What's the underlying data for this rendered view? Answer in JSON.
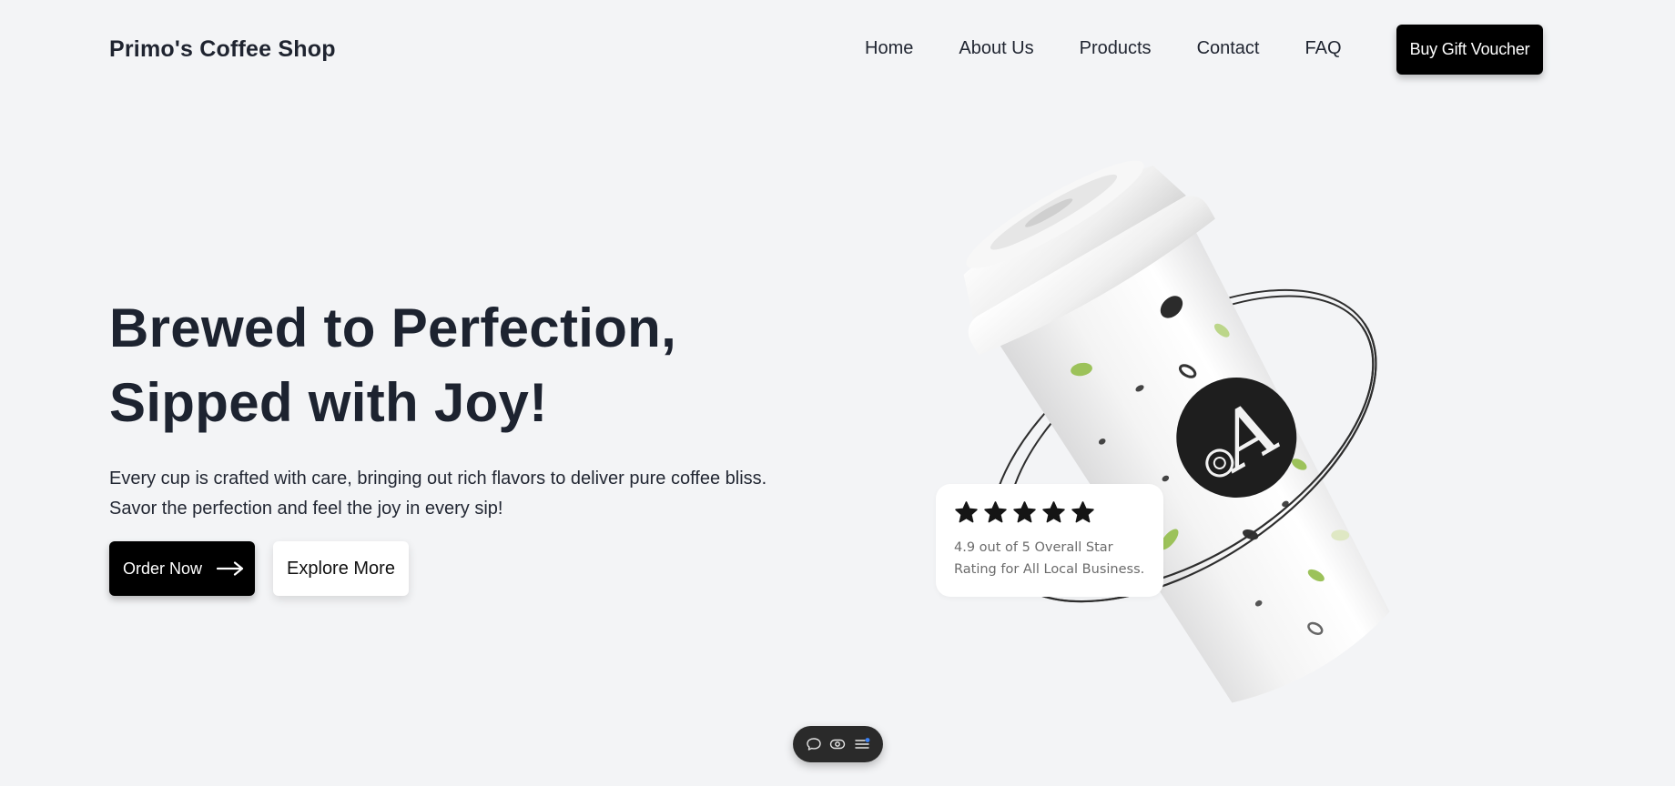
{
  "header": {
    "brand": "Primo's Coffee Shop",
    "nav": [
      "Home",
      "About Us",
      "Products",
      "Contact",
      "FAQ"
    ],
    "cta_label": "Buy Gift Voucher"
  },
  "hero": {
    "title_lines": [
      "Brewed to Perfection,",
      "Sipped with Joy!"
    ],
    "description_lines": [
      "Every cup is crafted with care, bringing out rich flavors to deliver pure coffee bliss.",
      "Savor the perfection and feel the joy in every sip!"
    ],
    "primary_button": "Order Now",
    "secondary_button": "Explore More"
  },
  "rating_card": {
    "stars": 5,
    "text_lines": [
      "4.9 out of 5 Overall Star",
      "Rating for All Local Business."
    ]
  },
  "toolbar": {
    "icons": [
      "chat-icon",
      "eye-icon",
      "menu-icon"
    ]
  },
  "colors": {
    "background": "#f3f4f6",
    "text": "#1f2430",
    "button_dark": "#000000",
    "leaf_green": "#9cc25a",
    "notification_blue": "#3b82f6"
  }
}
